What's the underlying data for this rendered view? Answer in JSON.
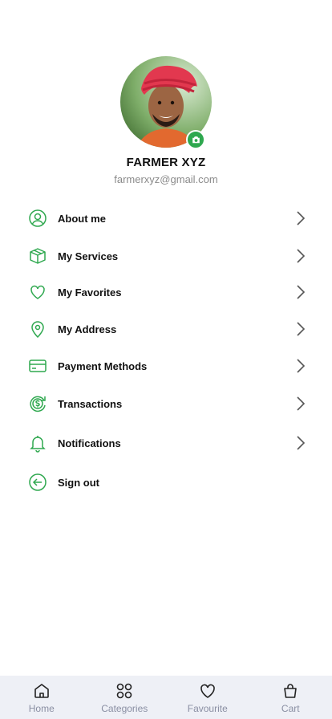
{
  "profile": {
    "name": "FARMER XYZ",
    "email": "farmerxyz@gmail.com"
  },
  "menu": {
    "items": [
      {
        "label": "About me",
        "icon": "user-circle-icon"
      },
      {
        "label": "My Services",
        "icon": "box-icon"
      },
      {
        "label": "My Favorites",
        "icon": "heart-icon"
      },
      {
        "label": "My Address",
        "icon": "location-pin-icon"
      },
      {
        "label": "Payment Methods",
        "icon": "credit-card-icon"
      },
      {
        "label": "Transactions",
        "icon": "dollar-cycle-icon"
      },
      {
        "label": "Notifications",
        "icon": "bell-icon"
      },
      {
        "label": "Sign out",
        "icon": "sign-out-icon"
      }
    ]
  },
  "bottom_nav": {
    "items": [
      {
        "label": "Home",
        "icon": "home-icon"
      },
      {
        "label": "Categories",
        "icon": "categories-icon"
      },
      {
        "label": "Favourite",
        "icon": "heart-icon"
      },
      {
        "label": "Cart",
        "icon": "bag-icon"
      }
    ]
  },
  "colors": {
    "accent": "#2fa84f",
    "text": "#111111",
    "muted": "#8a8a8a",
    "nav_bg": "#eef0f6",
    "nav_text": "#8a8fa3"
  }
}
